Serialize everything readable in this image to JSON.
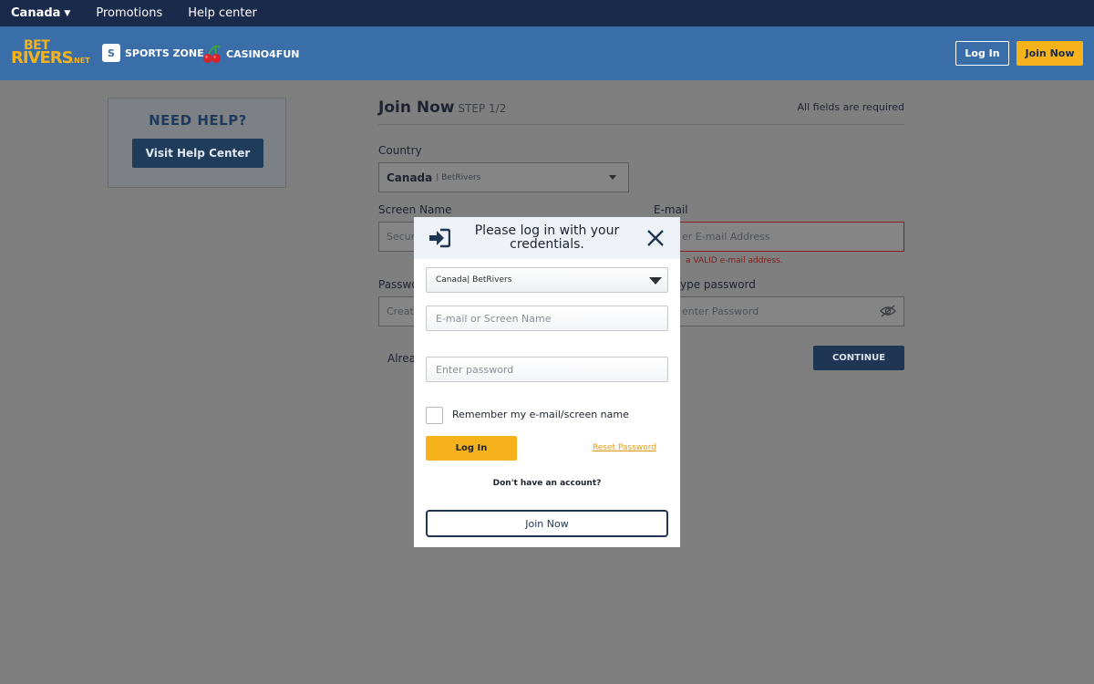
{
  "topbar": {
    "country": "Canada",
    "promotions": "Promotions",
    "help_center": "Help center"
  },
  "header": {
    "logo": {
      "line1": "BET",
      "line2": "RIVERS",
      "line3": ".NET"
    },
    "sports_zone": {
      "badge": "S",
      "label": "SPORTS ZONE"
    },
    "casino": {
      "label": "CASINO4FUN"
    },
    "login_label": "Log In",
    "join_label": "Join Now",
    "colors": {
      "bar": "#1a2a4a",
      "header": "#3a6ea8",
      "accent": "#f6b21a"
    }
  },
  "help": {
    "title": "NEED HELP?",
    "button": "Visit Help Center"
  },
  "form": {
    "title": "Join Now",
    "step": "STEP 1/2",
    "required_note": "All fields are required",
    "country_label": "Country",
    "country_value": "Canada",
    "country_sub": "| BetRivers",
    "screen_name_label": "Screen Name",
    "screen_name_placeholder": "Secur",
    "email_label": "E-mail",
    "email_placeholder": "er E-mail Address",
    "email_error": "a VALID e-mail address.",
    "password_label": "Passwo",
    "password_placeholder": "Creat",
    "retype_label": "ype password",
    "retype_placeholder": "enter Password",
    "already_text": "Alrea",
    "continue_label": "CONTINUE"
  },
  "modal": {
    "title": "Please log in with your credentials.",
    "site_select": "Canada| BetRivers",
    "email_placeholder": "E-mail or Screen Name",
    "password_placeholder": "Enter password",
    "remember_label": "Remember my e-mail/screen name",
    "remember_checked": false,
    "login_label": "Log In",
    "reset_label": "Reset Password",
    "no_account": "Don't have an account?",
    "join_label": "Join Now"
  },
  "icons": [
    "chevron-down-icon",
    "cherry-icon",
    "enter-icon",
    "close-icon",
    "eye-off-icon",
    "caret-down-icon"
  ]
}
